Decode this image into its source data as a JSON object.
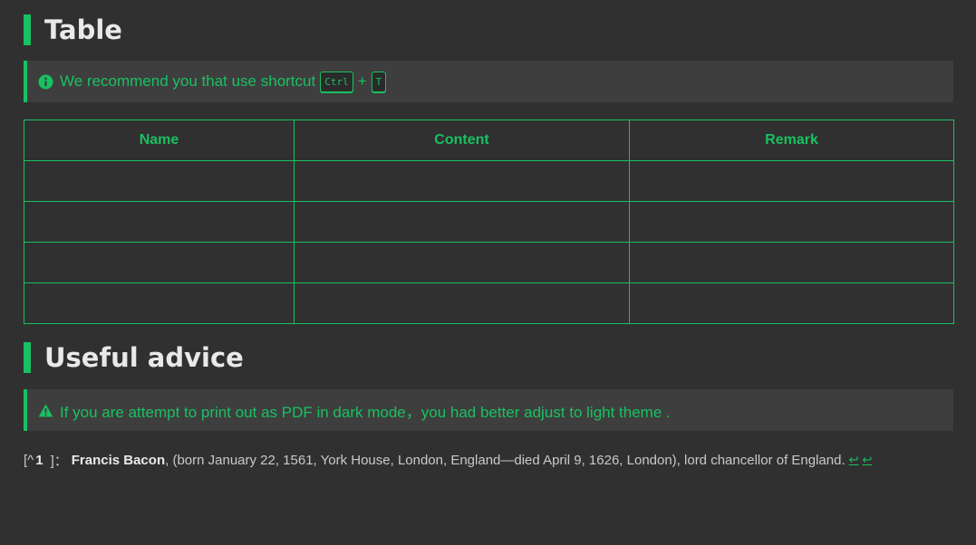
{
  "section_table": {
    "title": "Table",
    "tip_text": "We recommend you that use shortcut",
    "shortcut_key1": "Ctrl",
    "shortcut_plus": "+",
    "shortcut_key2": "T",
    "tip_icon": "info-circle-icon"
  },
  "table": {
    "headers": [
      "Name",
      "Content",
      "Remark"
    ],
    "rows": [
      [
        "",
        "",
        ""
      ],
      [
        "",
        "",
        ""
      ],
      [
        "",
        "",
        ""
      ],
      [
        "",
        "",
        ""
      ]
    ]
  },
  "section_advice": {
    "title": "Useful advice",
    "warning_text": "If you are attempt to print out as PDF in dark mode，you had better adjust to light theme .",
    "warning_icon": "warning-triangle-icon"
  },
  "footnote": {
    "ref_open": "[^",
    "ref_number": "1",
    "ref_close": "]：",
    "name": "Francis Bacon",
    "text": ", (born January 22, 1561, York House, London, England—died April 9, 1626, London), lord chancellor of England.",
    "backref1": "↩",
    "backref2": "↩"
  },
  "colors": {
    "accent": "#18c161",
    "background": "#303030",
    "callout_bg": "#3e3e3e",
    "heading_text": "#e9e9e9"
  }
}
